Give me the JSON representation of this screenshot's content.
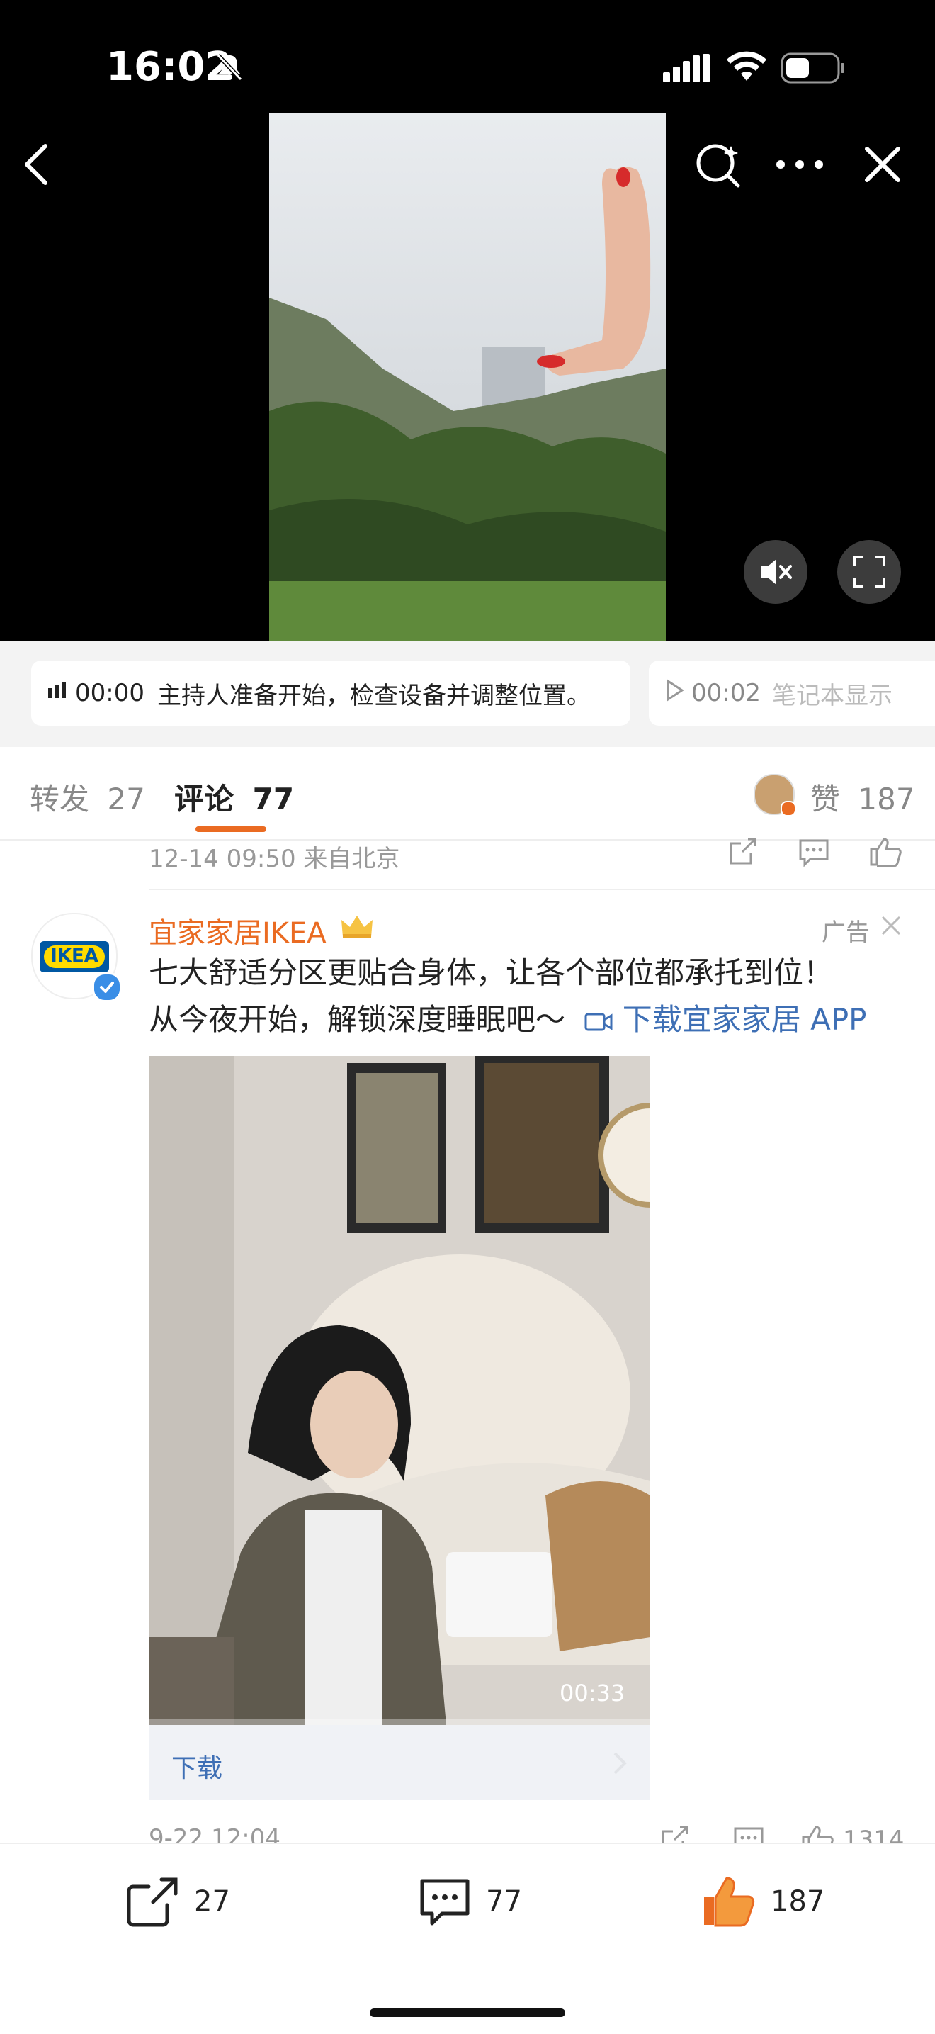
{
  "status_bar": {
    "time": "16:02"
  },
  "video_player": {
    "back_icon": "chevron-left-icon",
    "search_icon": "magnifier-icon",
    "more_icon": "ellipsis-icon",
    "close_icon": "close-icon",
    "mute_icon": "speaker-mute-icon",
    "fullscreen_icon": "fullscreen-icon"
  },
  "transcript": [
    {
      "time": "00:00",
      "text": "主持人准备开始，检查设备并调整位置。",
      "icon": "sound-bars-icon"
    },
    {
      "time": "00:02",
      "text": "笔记本显示",
      "icon": "play-icon"
    }
  ],
  "tabs": {
    "repost_label": "转发",
    "repost_count": "27",
    "comment_label": "评论",
    "comment_count": "77",
    "like_label": "赞",
    "like_count": "187"
  },
  "comments": {
    "prev_meta": "12-14 09:50 来自北京",
    "ad": {
      "name": "宜家家居IKEA",
      "logo_text": "IKEA",
      "tag": "广告",
      "body_line1": "七大舒适分区更贴合身体，让各个部位都承托到位！",
      "body_line2": "从今夜开始，解锁深度睡眠吧～",
      "link_text": "下载宜家家居 APP",
      "duration": "00:33",
      "cta": "下载",
      "meta": "9-22 12:04",
      "like_count": "1314"
    }
  },
  "bottom_bar": {
    "repost_count": "27",
    "comment_count": "77",
    "like_count": "187"
  },
  "colors": {
    "accent": "#ea6b22",
    "link": "#3e6fb5",
    "verified": "#3a8ee6",
    "ikea_blue": "#0058a3",
    "ikea_yellow": "#ffdb00"
  }
}
